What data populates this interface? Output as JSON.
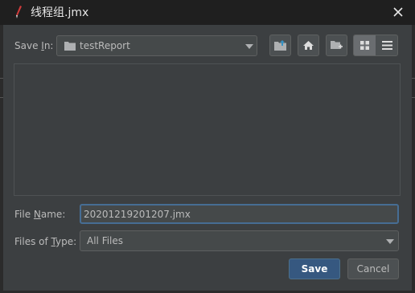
{
  "window": {
    "title": "线程组.jmx"
  },
  "save_in": {
    "label_pre": "Save ",
    "label_mnemonic": "I",
    "label_post": "n:",
    "value": "testReport"
  },
  "toolbar": {
    "up_icon": "folder-up-icon",
    "home_icon": "home-icon",
    "new_folder_icon": "new-folder-icon",
    "list_view_icon": "grid-view-icon",
    "details_view_icon": "details-view-icon"
  },
  "file_name": {
    "label_pre": "File ",
    "label_mnemonic": "N",
    "label_post": "ame:",
    "value": "20201219201207.jmx"
  },
  "files_of_type": {
    "label_pre": "Files of ",
    "label_mnemonic": "T",
    "label_post": "ype:",
    "value": "All Files"
  },
  "buttons": {
    "save": "Save",
    "cancel": "Cancel"
  },
  "colors": {
    "background": "#3c3f41",
    "titlebar": "#1f1f1f",
    "accent": "#365880",
    "focus_border": "#466d94"
  }
}
